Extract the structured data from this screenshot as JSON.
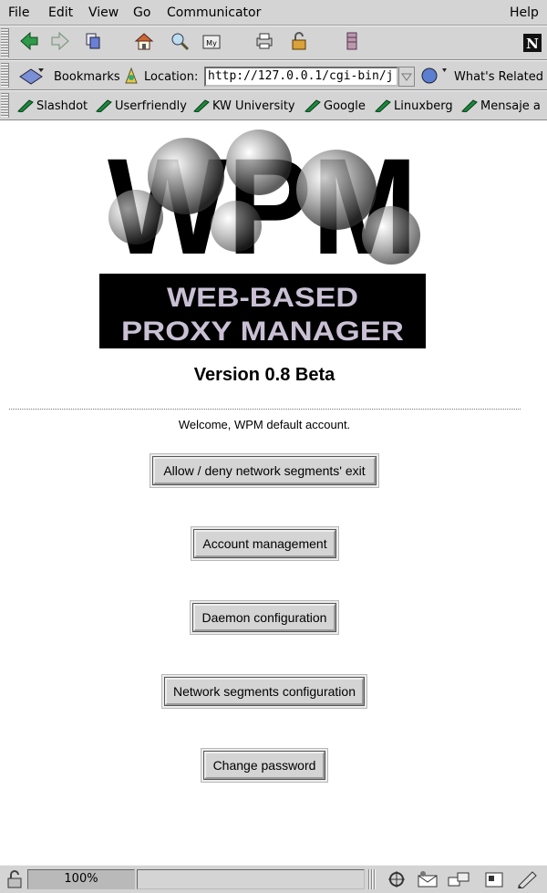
{
  "menubar": {
    "items": [
      "File",
      "Edit",
      "View",
      "Go",
      "Communicator"
    ],
    "help": "Help"
  },
  "nav_toolbar": {
    "icons": [
      "back-icon",
      "forward-icon",
      "reload-icon",
      "home-icon",
      "search-icon",
      "my-netscape-icon",
      "print-icon",
      "security-icon",
      "stop-icon",
      "netscape-logo-icon"
    ]
  },
  "location_bar": {
    "bookmarks_label": "Bookmarks",
    "location_label": "Location:",
    "url": "http://127.0.0.1/cgi-bin/j",
    "whats_related_label": "What's Related"
  },
  "personal_toolbar": {
    "items": [
      "Slashdot",
      "Userfriendly",
      "KW University",
      "Google",
      "Linuxberg",
      "Mensaje a"
    ]
  },
  "page": {
    "logo_line1": "WEB-BASED",
    "logo_line2": "PROXY MANAGER",
    "logo_letters": "WPM",
    "version": "Version 0.8 Beta",
    "welcome": "Welcome, WPM default account.",
    "buttons": [
      "Allow / deny network segments' exit",
      "Account management",
      "Daemon configuration",
      "Network segments configuration",
      "Change password"
    ]
  },
  "statusbar": {
    "progress": "100%"
  },
  "colors": {
    "chrome": "#d4d4d4",
    "logo_band": "#000000",
    "accent_green": "#1a8a3c"
  }
}
